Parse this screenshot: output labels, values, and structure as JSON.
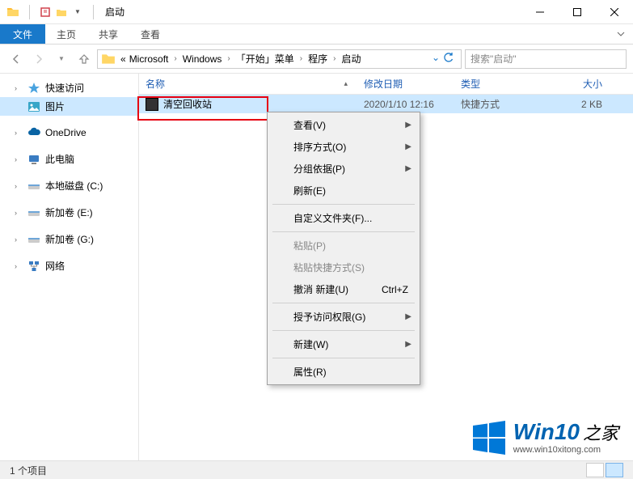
{
  "window": {
    "title": "启动"
  },
  "ribbon": {
    "file": "文件",
    "tabs": [
      "主页",
      "共享",
      "查看"
    ]
  },
  "breadcrumb": {
    "prefix": "«",
    "segments": [
      "Microsoft",
      "Windows",
      "「开始」菜单",
      "程序",
      "启动"
    ],
    "refresh_dropdown": "⌄"
  },
  "search": {
    "placeholder": "搜索\"启动\""
  },
  "sidebar": {
    "items": [
      {
        "label": "快速访问",
        "icon": "star",
        "color": "#4aa3df",
        "hasArrow": true
      },
      {
        "label": "图片",
        "icon": "picture",
        "color": "#38a6c8",
        "hasArrow": false,
        "selected": true
      },
      {
        "spacer": true
      },
      {
        "label": "OneDrive",
        "icon": "cloud",
        "color": "#0a64a4",
        "hasArrow": true
      },
      {
        "spacer": true
      },
      {
        "label": "此电脑",
        "icon": "pc",
        "color": "#3a7cc2",
        "hasArrow": true
      },
      {
        "spacer": true
      },
      {
        "label": "本地磁盘 (C:)",
        "icon": "drive",
        "color": "#6ea6d8",
        "hasArrow": true
      },
      {
        "spacer": true
      },
      {
        "label": "新加卷 (E:)",
        "icon": "drive",
        "color": "#888",
        "hasArrow": true
      },
      {
        "spacer": true
      },
      {
        "label": "新加卷 (G:)",
        "icon": "drive",
        "color": "#888",
        "hasArrow": true
      },
      {
        "spacer": true
      },
      {
        "label": "网络",
        "icon": "network",
        "color": "#3a7cc2",
        "hasArrow": true
      }
    ]
  },
  "columns": {
    "name": "名称",
    "date": "修改日期",
    "type": "类型",
    "size": "大小"
  },
  "files": [
    {
      "name": "清空回收站",
      "date": "2020/1/10 12:16",
      "type": "快捷方式",
      "size": "2 KB"
    }
  ],
  "contextMenu": {
    "items": [
      {
        "label": "查看(V)",
        "submenu": true
      },
      {
        "label": "排序方式(O)",
        "submenu": true
      },
      {
        "label": "分组依据(P)",
        "submenu": true
      },
      {
        "label": "刷新(E)"
      },
      {
        "sep": true
      },
      {
        "label": "自定义文件夹(F)..."
      },
      {
        "sep": true
      },
      {
        "label": "粘贴(P)",
        "disabled": true
      },
      {
        "label": "粘贴快捷方式(S)",
        "disabled": true
      },
      {
        "label": "撤消 新建(U)",
        "shortcut": "Ctrl+Z"
      },
      {
        "sep": true
      },
      {
        "label": "授予访问权限(G)",
        "submenu": true
      },
      {
        "sep": true
      },
      {
        "label": "新建(W)",
        "submenu": true
      },
      {
        "sep": true
      },
      {
        "label": "属性(R)"
      }
    ]
  },
  "statusbar": {
    "count": "1 个项目"
  },
  "watermark": {
    "title": "Win10",
    "suffix": "之家",
    "site": "www.win10xitong.com"
  }
}
